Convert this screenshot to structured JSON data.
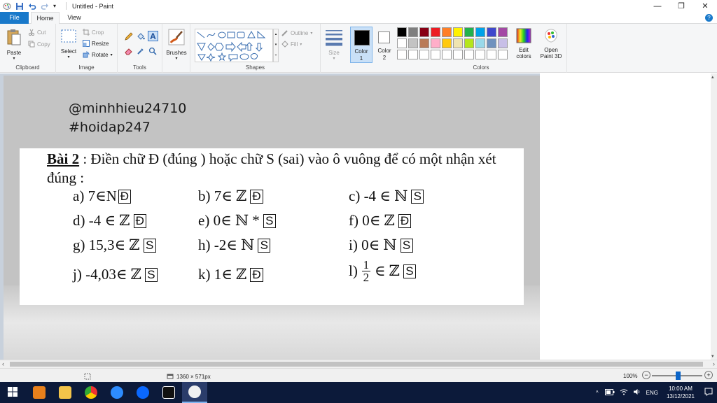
{
  "window": {
    "title": "Untitled - Paint",
    "controls": {
      "minimize": "—",
      "restore": "❐",
      "close": "✕"
    }
  },
  "tabs": {
    "file": "File",
    "home": "Home",
    "view": "View"
  },
  "ribbon": {
    "clipboard": {
      "label": "Clipboard",
      "paste": "Paste",
      "cut": "Cut",
      "copy": "Copy"
    },
    "image": {
      "label": "Image",
      "select": "Select",
      "crop": "Crop",
      "resize": "Resize",
      "rotate": "Rotate"
    },
    "tools": {
      "label": "Tools"
    },
    "brushes": {
      "label": "Brushes"
    },
    "shapes": {
      "label": "Shapes",
      "outline": "Outline",
      "fill": "Fill"
    },
    "size": {
      "label": "Size"
    },
    "color1": {
      "label": "Color\n1",
      "line1": "Color",
      "line2": "1",
      "value": "#000000"
    },
    "color2": {
      "line1": "Color",
      "line2": "2",
      "value": "#ffffff"
    },
    "colors": {
      "label": "Colors",
      "row1": [
        "#000000",
        "#7f7f7f",
        "#880015",
        "#ed1c24",
        "#ff7f27",
        "#fff200",
        "#22b14c",
        "#00a2e8",
        "#3f48cc",
        "#a349a4"
      ],
      "row2": [
        "#ffffff",
        "#c3c3c3",
        "#b97a57",
        "#ffaec9",
        "#ffc90e",
        "#efe4b0",
        "#b5e61d",
        "#99d9ea",
        "#7092be",
        "#c8bfe7"
      ],
      "row3": [
        "#ffffff",
        "#ffffff",
        "#ffffff",
        "#ffffff",
        "#ffffff",
        "#ffffff",
        "#ffffff",
        "#ffffff",
        "#ffffff",
        "#ffffff"
      ],
      "edit_line1": "Edit",
      "edit_line2": "colors",
      "open3d_line1": "Open",
      "open3d_line2": "Paint 3D"
    }
  },
  "canvas": {
    "handle1": "@minhhieu24710",
    "handle2": "#hoidap247",
    "exercise": {
      "title_bold": "Bài 2",
      "title_rest": " :  Điền chữ Đ (đúng ) hoặc chữ S (sai) vào ô vuông để có một nhận xét đúng :",
      "items": [
        {
          "expr": "a) 7∈N",
          "answer": "Đ"
        },
        {
          "expr": "b) 7∈ ℤ",
          "answer": "Đ"
        },
        {
          "expr": "c) -4 ∈ ℕ",
          "answer": "S"
        },
        {
          "expr": "d) -4 ∈ ℤ",
          "answer": "Đ"
        },
        {
          "expr": "e) 0∈ ℕ *",
          "answer": "S"
        },
        {
          "expr": "f) 0∈ ℤ",
          "answer": "Đ"
        },
        {
          "expr": "g) 15,3∈ ℤ",
          "answer": "S"
        },
        {
          "expr": "h) -2∈ ℕ",
          "answer": "S"
        },
        {
          "expr": "i) 0∈ ℕ",
          "answer": "S"
        },
        {
          "expr": "j) -4,03∈ ℤ",
          "answer": "S"
        },
        {
          "expr": "k) 1∈ ℤ",
          "answer": "Đ"
        },
        {
          "expr_prefix": "l)",
          "frac_num": "1",
          "frac_den": "2",
          "expr_suffix": "∈ ℤ",
          "answer": "S"
        }
      ]
    }
  },
  "statusbar": {
    "dimensions": "1360 × 571px",
    "zoom": "100%",
    "zoom_minus": "−",
    "zoom_plus": "+"
  },
  "taskbar": {
    "language": "ENG",
    "time": "10:00 AM",
    "date": "13/12/2021",
    "tray_chevron": "^"
  }
}
